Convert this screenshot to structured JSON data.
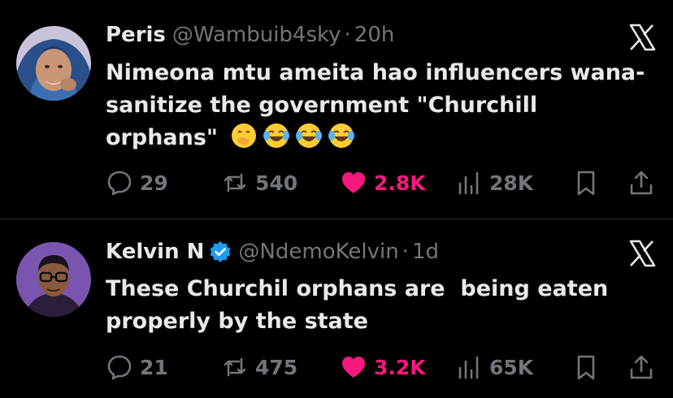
{
  "tweets": [
    {
      "author": {
        "name": "Peris",
        "handle": "@Wambuib4sky",
        "verified": false
      },
      "separator": "·",
      "time": "20h",
      "text": "Nimeona mtu ameita hao influencers wana-sanitize the government \"Churchill orphans\"",
      "emojis": [
        "face-with-hand-over-mouth",
        "face-with-tears-of-joy",
        "face-with-tears-of-joy",
        "face-with-tears-of-joy"
      ],
      "stats": {
        "replies": "29",
        "reposts": "540",
        "likes": "2.8K",
        "views": "28K"
      },
      "liked": true
    },
    {
      "author": {
        "name": "Kelvin N",
        "handle": "@NdemoKelvin",
        "verified": true
      },
      "separator": "·",
      "time": "1d",
      "text": "These Churchil orphans are  being eaten properly by the state",
      "emojis": [],
      "stats": {
        "replies": "21",
        "reposts": "475",
        "likes": "3.2K",
        "views": "65K"
      },
      "liked": true
    }
  ],
  "colors": {
    "background": "#000000",
    "text_primary": "#e7e9ea",
    "text_secondary": "#71767b",
    "like": "#f91880",
    "verified": "#1d9bf0",
    "divider": "#2f3336"
  },
  "icons": {
    "reply": "reply-icon",
    "repost": "repost-icon",
    "like": "heart-icon",
    "views": "views-icon",
    "bookmark": "bookmark-icon",
    "share": "share-icon",
    "brand": "x-logo-icon",
    "verified": "verified-badge-icon"
  }
}
